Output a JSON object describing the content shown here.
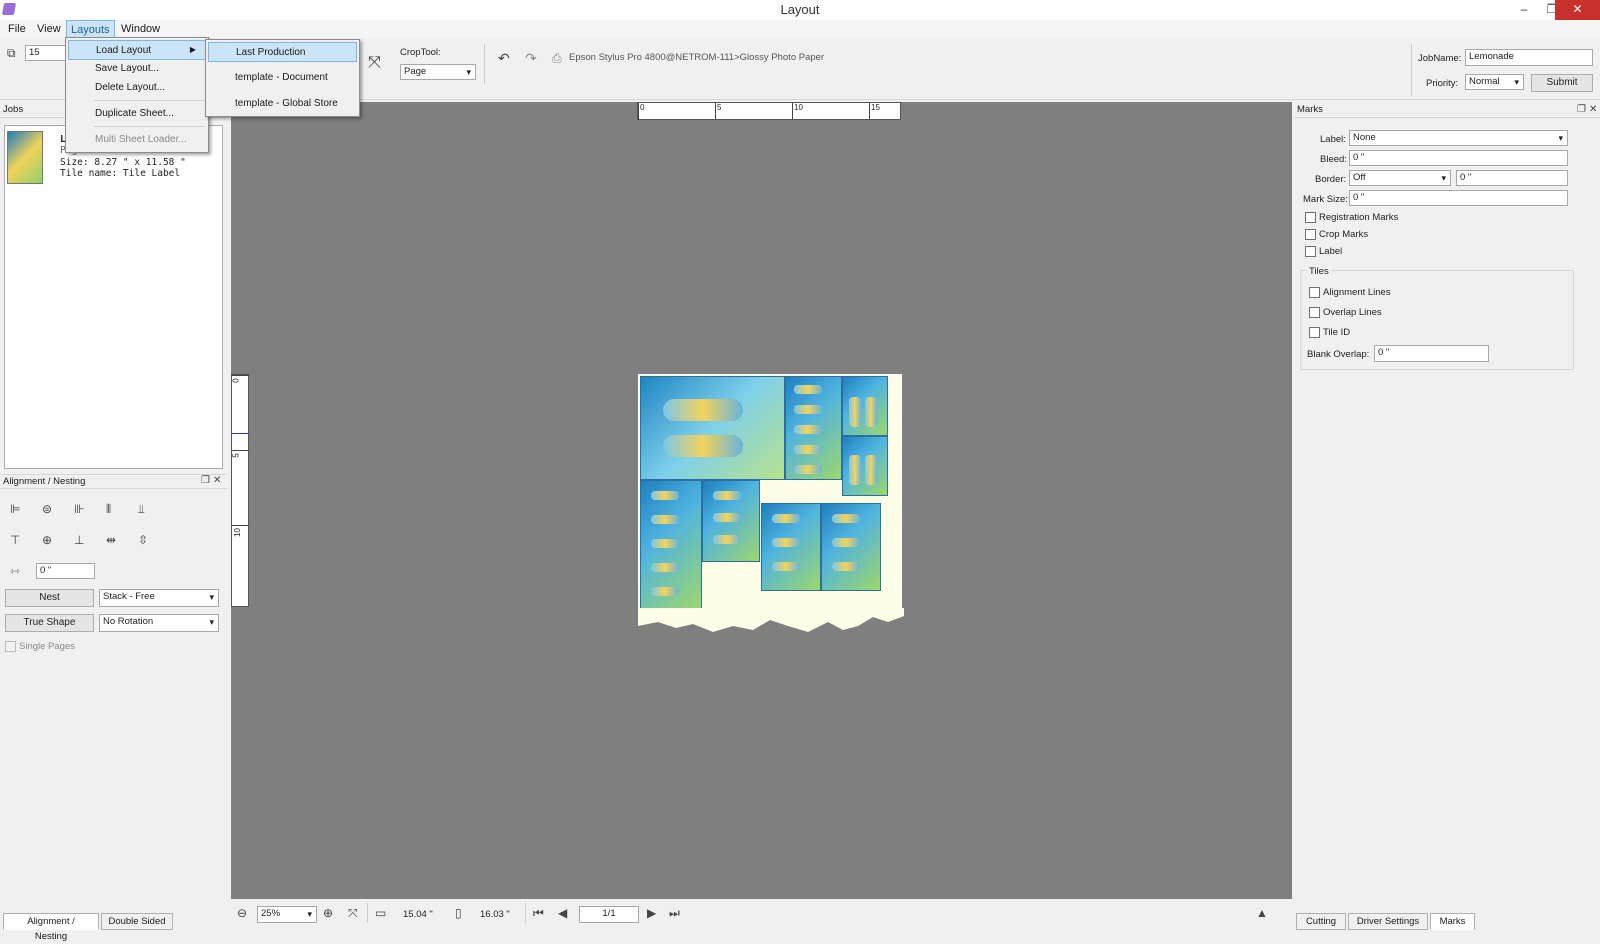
{
  "window": {
    "title": "Layout"
  },
  "menubar": {
    "items": [
      "File",
      "View",
      "Layouts",
      "Window"
    ]
  },
  "layouts_menu": {
    "items": [
      "Load Layout",
      "Save Layout...",
      "Delete Layout...",
      "Duplicate Sheet...",
      "Multi Sheet Loader..."
    ]
  },
  "load_layout_submenu": {
    "items": [
      "Last Production",
      "template - Document",
      "template - Global Store"
    ]
  },
  "toolbar": {
    "copies_value": "15",
    "croptool_label": "CropTool:",
    "croptool_value": "Page",
    "printer_text": "Epson Stylus Pro 4800@NETROM-111>Glossy Photo Paper",
    "jobname_label": "JobName:",
    "jobname_value": "Lemonade",
    "priority_label": "Priority:",
    "priority_value": "Normal",
    "submit_label": "Submit"
  },
  "jobs_panel": {
    "title": "Jobs",
    "job": {
      "name_partial": "L",
      "page_partial": "Page: 1",
      "size": "Size: 8.27 \" x 11.58 \"",
      "tile_name": "Tile name: Tile Label"
    }
  },
  "alignment_panel": {
    "title": "Alignment / Nesting",
    "spacing_value": "0 \"",
    "nest_label": "Nest",
    "nest_mode": "Stack - Free",
    "true_shape_label": "True Shape",
    "rotation_mode": "No Rotation",
    "single_pages_label": "Single Pages"
  },
  "ruler_h": {
    "labels": [
      "0",
      "5",
      "10",
      "15"
    ]
  },
  "ruler_v": {
    "labels": [
      "0",
      "5",
      "10"
    ]
  },
  "marks_panel": {
    "title": "Marks",
    "label_label": "Label:",
    "label_value": "None",
    "bleed_label": "Bleed:",
    "bleed_value": "0 \"",
    "border_label": "Border:",
    "border_value": "Off",
    "border_size": "0 \"",
    "mark_size_label": "Mark Size:",
    "mark_size_value": "0 \"",
    "registration_marks": "Registration Marks",
    "crop_marks": "Crop Marks",
    "label_check": "Label",
    "tiles_title": "Tiles",
    "alignment_lines": "Alignment Lines",
    "overlap_lines": "Overlap Lines",
    "tile_id": "Tile ID",
    "blank_overlap_label": "Blank Overlap:",
    "blank_overlap_value": "0 \""
  },
  "statusbar": {
    "zoom": "25%",
    "width": "15.04 \"",
    "height": "16.03 \"",
    "page": "1/1"
  },
  "bottom_tabs_left": [
    "Alignment / Nesting",
    "Double Sided"
  ],
  "bottom_tabs_right": [
    "Cutting",
    "Driver Settings",
    "Marks"
  ]
}
